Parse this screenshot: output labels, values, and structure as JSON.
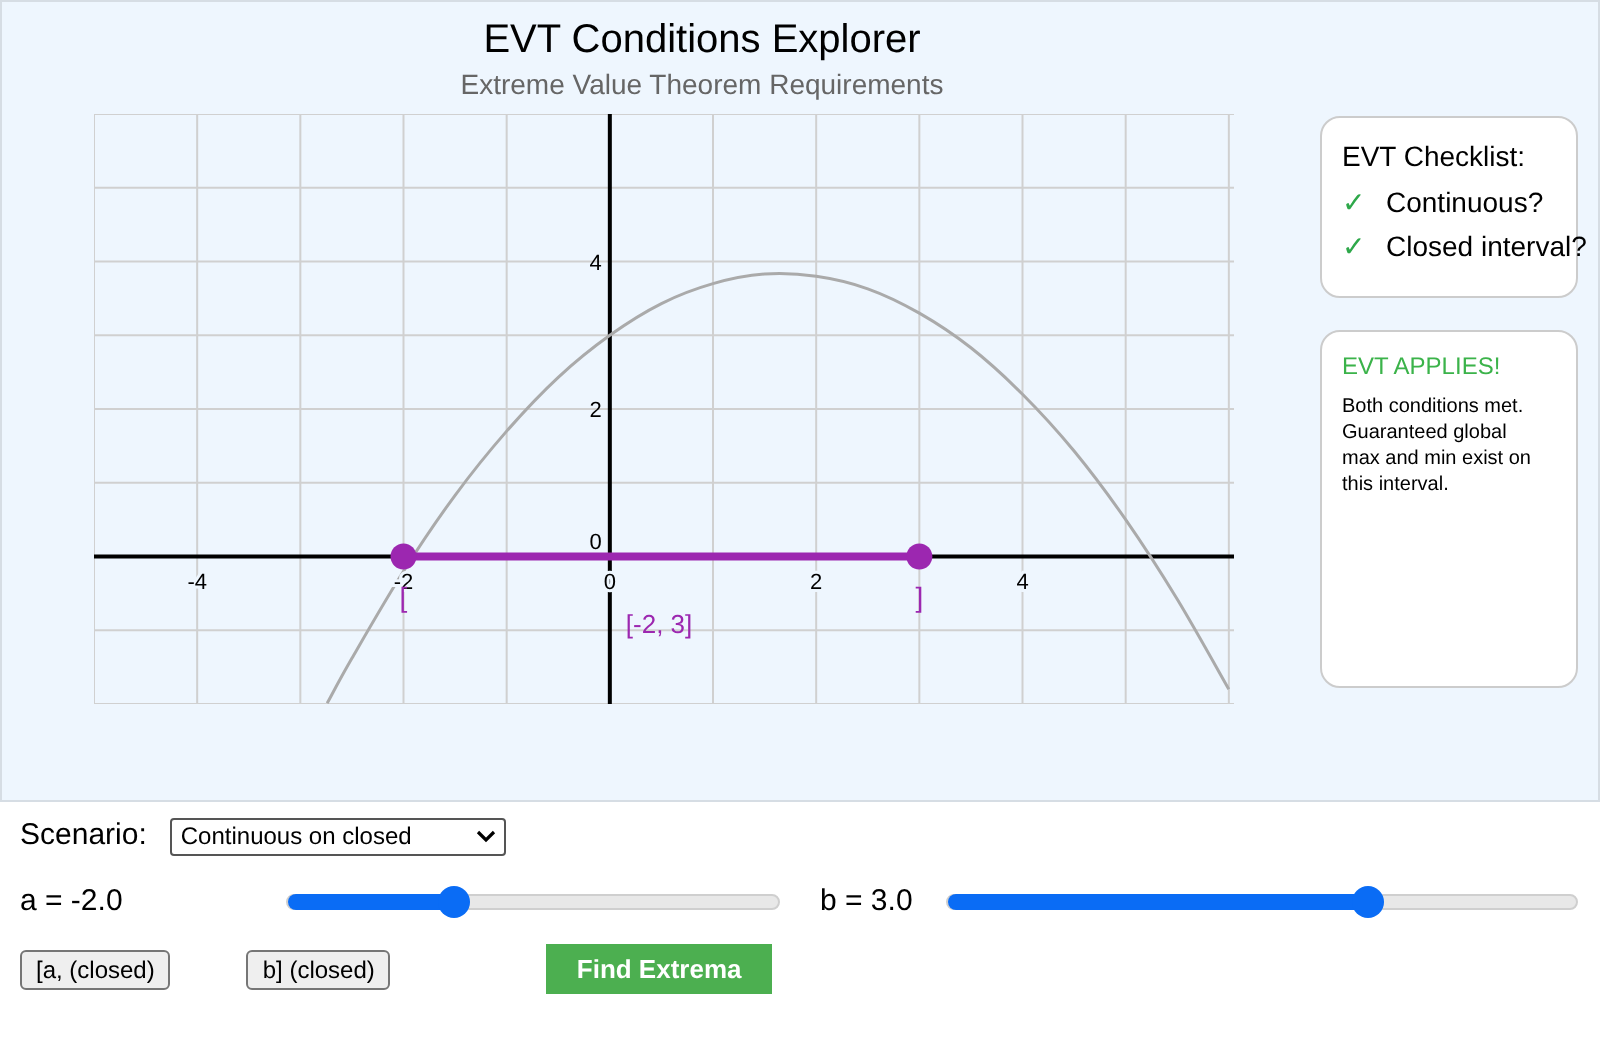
{
  "header": {
    "title": "EVT Conditions Explorer",
    "subtitle": "Extreme Value Theorem Requirements"
  },
  "plot": {
    "chart_data": {
      "type": "line",
      "x": [
        -2.74,
        -2.5,
        -2,
        -1.5,
        -1,
        -0.5,
        0,
        0.5,
        1,
        1.5,
        2,
        2.5,
        3,
        3.5,
        4,
        4.5,
        5,
        5.5,
        6
      ],
      "series": [
        {
          "color": "#aaaaaa",
          "values": [
            -1.99,
            -1.38,
            -0.2,
            0.83,
            1.7,
            2.43,
            3,
            3.43,
            3.7,
            3.83,
            3.8,
            3.63,
            3.3,
            2.83,
            2.2,
            1.43,
            0.5,
            -0.58,
            -1.8
          ]
        }
      ],
      "xlim": [
        -5,
        6.05
      ],
      "ylim": [
        -2,
        6
      ],
      "xticks": [
        -4,
        -2,
        0,
        2,
        4
      ],
      "yticks": [
        0,
        2,
        4
      ],
      "grid": true
    },
    "interval": {
      "color": "#9c27b0",
      "left_mark": "[",
      "right_mark": "]",
      "label": "[-2, 3]"
    }
  },
  "checklist": {
    "title": "EVT Checklist:",
    "items": [
      {
        "mark": "✓",
        "label": "Continuous?",
        "checked": true
      },
      {
        "mark": "✓",
        "label": "Closed interval?",
        "checked": true
      }
    ]
  },
  "status": {
    "applies": true,
    "title": "EVT APPLIES!",
    "text": "Both conditions met. Guaranteed global max and min exist on this interval."
  },
  "controls": {
    "scenario_label": "Scenario:",
    "scenario_value": "Continuous on closed",
    "sliders": [
      {
        "label": "a = -2.0",
        "level": 0.34
      },
      {
        "label": "b = 3.0",
        "level": 0.67
      }
    ],
    "buttons": [
      {
        "label": "[a, (closed)",
        "kind": "toggle"
      },
      {
        "label": "b] (closed)",
        "kind": "toggle"
      },
      {
        "label": "Find Extrema",
        "kind": "primary"
      }
    ]
  }
}
